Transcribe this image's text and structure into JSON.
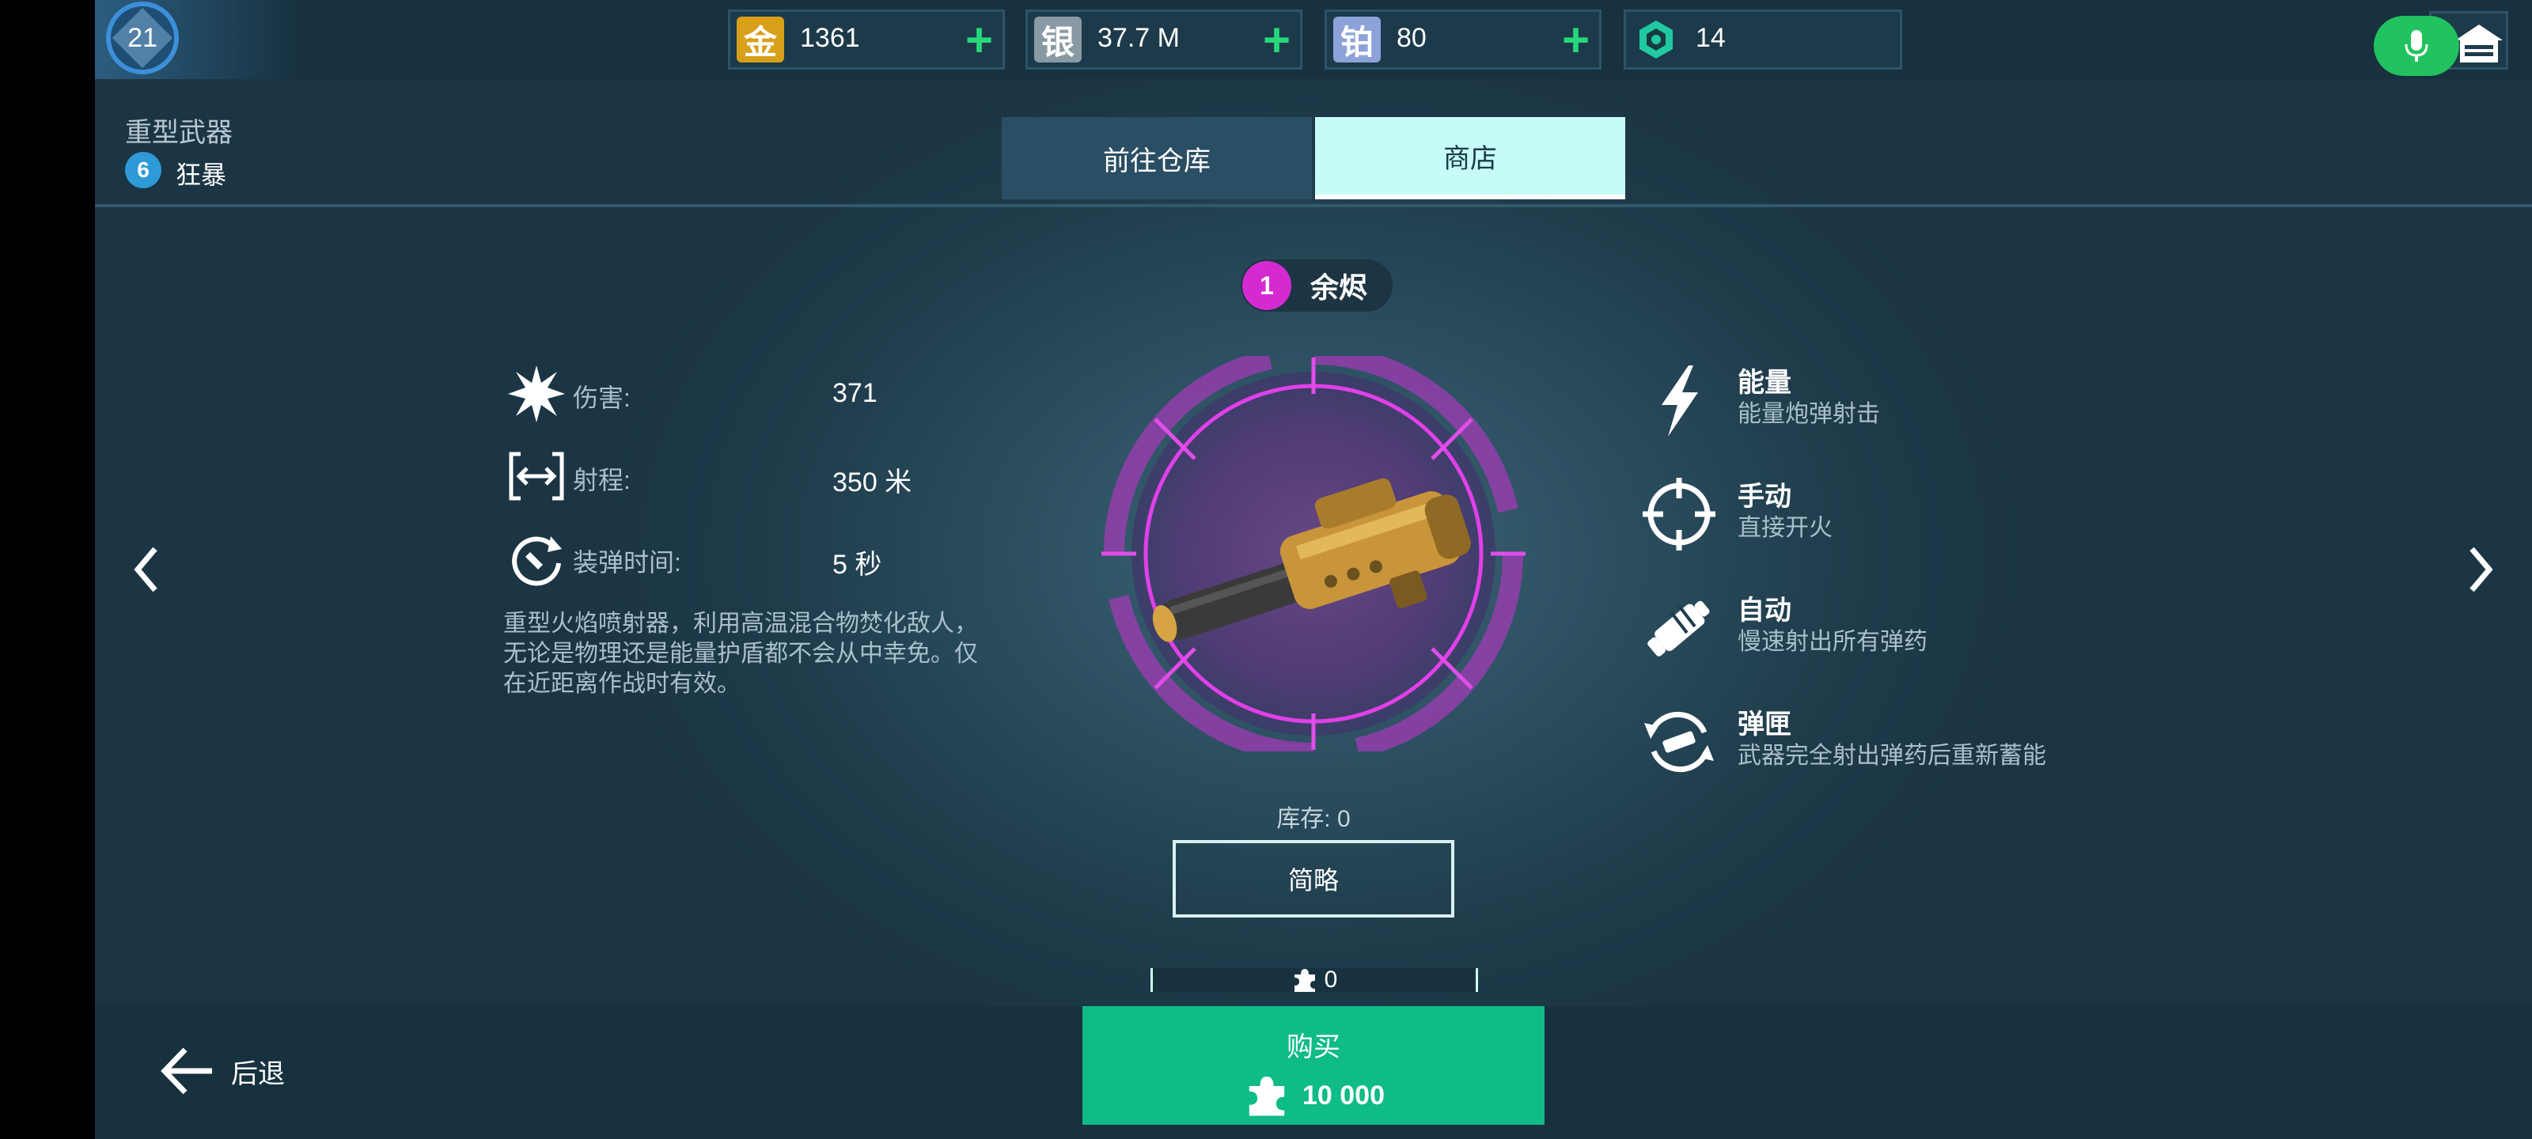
{
  "player": {
    "level": "21"
  },
  "currencies": [
    {
      "icon": "gold-icon",
      "glyph": "金",
      "value": "1361",
      "color": "#d8a018"
    },
    {
      "icon": "silver-icon",
      "glyph": "银",
      "value": "37.7 M",
      "color": "#8a9aa4"
    },
    {
      "icon": "platinum-icon",
      "glyph": "铂",
      "value": "80",
      "color": "#8da2d8"
    },
    {
      "icon": "power-cell-icon",
      "glyph": "",
      "value": "14",
      "color": "#20c9a3"
    }
  ],
  "header": {
    "category": "重型武器",
    "tier_number": "6",
    "tier_name": "狂暴"
  },
  "tabs": {
    "warehouse": "前往仓库",
    "shop": "商店"
  },
  "weapon": {
    "tier_number": "1",
    "name": "余烬",
    "stats": [
      {
        "label": "伤害:",
        "value": "371",
        "icon": "damage-burst-icon"
      },
      {
        "label": "射程:",
        "value": "350 米",
        "icon": "range-icon"
      },
      {
        "label": "装弹时间:",
        "value": "5 秒",
        "icon": "reload-icon"
      }
    ],
    "description": "重型火焰喷射器，利用高温混合物焚化敌人，无论是物理还是能量护盾都不会从中幸免。仅在近距离作战时有效。",
    "stock": "库存: 0",
    "brief_button": "简略",
    "blueprints_owned": "0",
    "features": [
      {
        "title": "能量",
        "subtitle": "能量炮弹射击",
        "icon": "lightning-icon"
      },
      {
        "title": "手动",
        "subtitle": "直接开火",
        "icon": "crosshair-icon"
      },
      {
        "title": "自动",
        "subtitle": "慢速射出所有弹药",
        "icon": "auto-fire-icon"
      },
      {
        "title": "弹匣",
        "subtitle": "武器完全射出弹药后重新蓄能",
        "icon": "magazine-reload-icon"
      }
    ]
  },
  "bottom": {
    "back": "后退",
    "buy": "购买",
    "price": "10 000"
  },
  "colors": {
    "accent_green": "#0fbb86",
    "tier_magenta": "#d52ad2",
    "tier_blue": "#2f9ad8"
  }
}
